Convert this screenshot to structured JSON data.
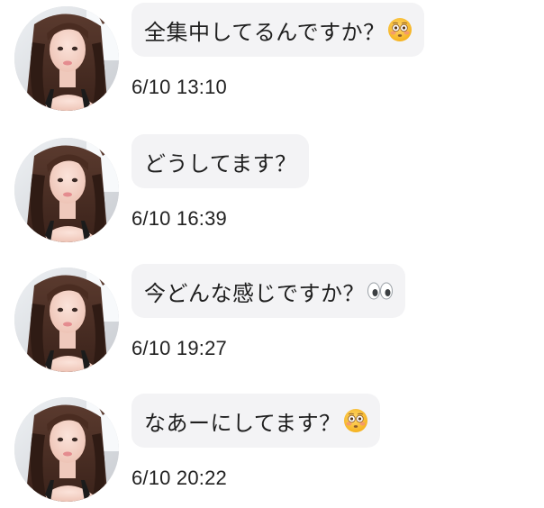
{
  "colors": {
    "bubble_bg": "#f3f3f5",
    "text": "#1f1f1f",
    "timestamp": "#222222"
  },
  "messages": [
    {
      "text": "全集中してるんですか？",
      "emoji": "flushed-face-icon",
      "time": "6/10 13:10"
    },
    {
      "text": "どうしてます？",
      "emoji": "",
      "time": "6/10 16:39"
    },
    {
      "text": "今どんな感じですか？",
      "emoji": "eyes-icon",
      "time": "6/10 19:27"
    },
    {
      "text": "なあーにしてます？",
      "emoji": "flushed-face-icon",
      "time": "6/10 20:22"
    }
  ]
}
